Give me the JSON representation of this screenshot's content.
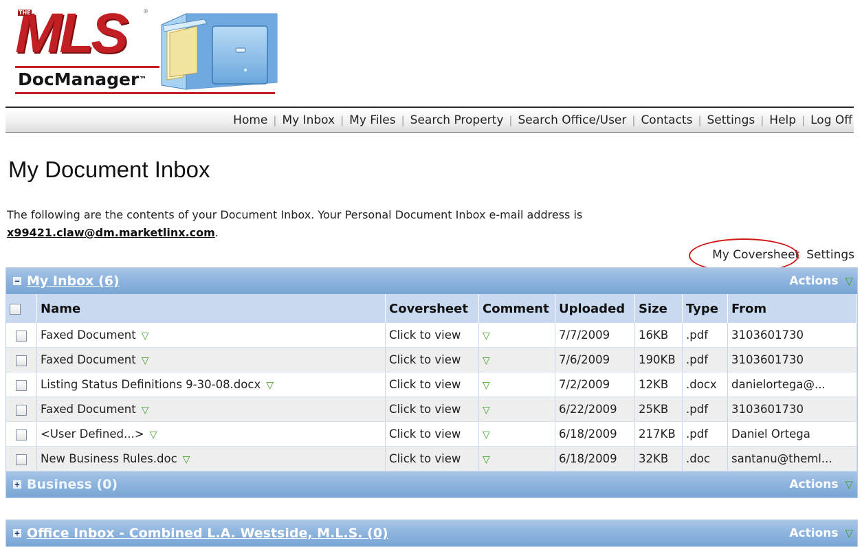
{
  "logo": {
    "the": "THE",
    "mls": "MLS",
    "reg": "®",
    "product": "DocManager",
    "tm": "™"
  },
  "nav": {
    "items": [
      "Home",
      "My Inbox",
      "My Files",
      "Search Property",
      "Search Office/User",
      "Contacts",
      "Settings",
      "Help",
      "Log Off"
    ],
    "separator": "|"
  },
  "page": {
    "title": "My Document Inbox",
    "intro": "The following are the contents of your Document Inbox. Your Personal Document Inbox e-mail address is",
    "email": "x99421.claw@dm.marketlinx.com",
    "email_suffix": "."
  },
  "util_links": {
    "coversheet": "My Coversheet",
    "settings": "Settings"
  },
  "inbox": {
    "toggle": "−",
    "title": "My Inbox (6)",
    "actions": "Actions",
    "columns": [
      "Name",
      "Coversheet",
      "Comment",
      "Uploaded",
      "Size",
      "Type",
      "From"
    ],
    "rows": [
      {
        "name": "Faxed Document",
        "coversheet": "Click to view",
        "uploaded": "7/7/2009",
        "size": "16KB",
        "type": ".pdf",
        "from": "3103601730"
      },
      {
        "name": "Faxed Document",
        "coversheet": "Click to view",
        "uploaded": "7/6/2009",
        "size": "190KB",
        "type": ".pdf",
        "from": "3103601730"
      },
      {
        "name": "Listing Status Definitions 9-30-08.docx",
        "coversheet": "Click to view",
        "uploaded": "7/2/2009",
        "size": "12KB",
        "type": ".docx",
        "from": "danielortega@..."
      },
      {
        "name": "Faxed Document",
        "coversheet": "Click to view",
        "uploaded": "6/22/2009",
        "size": "25KB",
        "type": ".pdf",
        "from": "3103601730"
      },
      {
        "name": "<User Defined...>",
        "coversheet": "Click to view",
        "uploaded": "6/18/2009",
        "size": "217KB",
        "type": ".pdf",
        "from": "Daniel Ortega"
      },
      {
        "name": "New Business Rules.doc",
        "coversheet": "Click to view",
        "uploaded": "6/18/2009",
        "size": "32KB",
        "type": ".doc",
        "from": "santanu@theml..."
      }
    ]
  },
  "business": {
    "toggle": "+",
    "title": "Business (0)",
    "actions": "Actions"
  },
  "office": {
    "toggle": "+",
    "title": "Office Inbox - Combined L.A. Westside, M.L.S. (0)",
    "actions": "Actions"
  },
  "icons": {
    "caret": "triangle-down-icon",
    "glyph": "▽"
  },
  "colors": {
    "brand_red": "#c21f24",
    "header_blue": "#8ab2dd",
    "column_header": "#c8d9f0",
    "caret_green": "#3d9b20",
    "annotation_red": "#d01818"
  }
}
